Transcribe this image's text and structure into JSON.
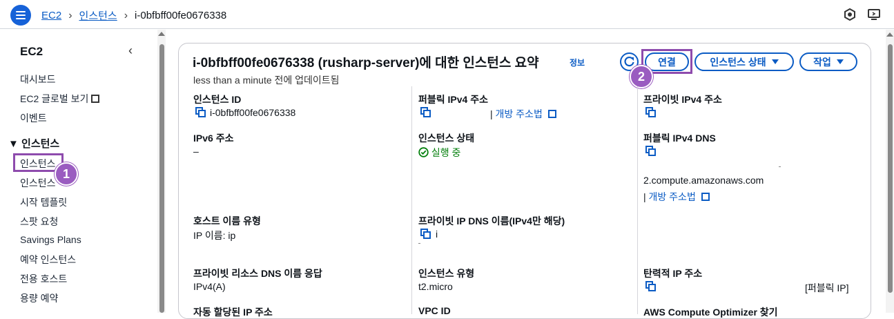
{
  "topbar": {
    "breadcrumbs": [
      "EC2",
      "인스턴스"
    ],
    "current": "i-0bfbff00fe0676338"
  },
  "sidebar": {
    "title": "EC2",
    "items_top": [
      "대시보드",
      "EC2 글로벌 보기",
      "이벤트"
    ],
    "section": "▼ 인스턴스",
    "items": [
      "인스턴스",
      "인스턴스 유형",
      "시작 템플릿",
      "스팟 요청",
      "Savings Plans",
      "예약 인스턴스",
      "전용 호스트",
      "용량 예약"
    ],
    "items_visible": [
      "인스턴스",
      "인스턴스",
      "시작 템플릿",
      "스팟 요청",
      "Savings Plans",
      "예약 인스턴스",
      "전용 호스트",
      "용량 예약"
    ]
  },
  "annotations": {
    "badge1": "1",
    "badge2": "2"
  },
  "summary": {
    "title": "i-0bfbff00fe0676338 (rusharp-server)에 대한 인스턴스 요약",
    "info": "정보",
    "updated": "less than a minute 전에 업데이트됨",
    "connect_label": "연결",
    "state_label": "인스턴스 상태",
    "actions_label": "작업",
    "fields": {
      "instance_id_label": "인스턴스 ID",
      "instance_id_value": "i-0bfbff00fe0676338",
      "public_ipv4_label": "퍼블릭 IPv4 주소",
      "open_address_link": "개방 주소법",
      "private_ipv4_label": "프라이빗 IPv4 주소",
      "ipv6_label": "IPv6 주소",
      "ipv6_value": "–",
      "instance_state_label": "인스턴스 상태",
      "instance_state_value": "실행 중",
      "public_dns_label": "퍼블릭 IPv4 DNS",
      "public_dns_value": "2.compute.amazonaws.com",
      "public_dns_link": "개방 주소법",
      "hostname_type_label": "호스트 이름 유형",
      "hostname_type_value": "IP 이름: ip",
      "private_dns_label": "프라이빗 IP DNS 이름(IPv4만 해당)",
      "private_dns_value": "i",
      "private_resource_dns_label": "프라이빗 리소스 DNS 이름 응답",
      "private_resource_dns_value": "IPv4(A)",
      "instance_type_label": "인스턴스 유형",
      "instance_type_value": "t2.micro",
      "elastic_ip_label": "탄력적 IP 주소",
      "elastic_ip_value": "[퍼블릭 IP]",
      "auto_ip_label": "자동 할당된 IP 주소",
      "vpc_label": "VPC ID",
      "optimizer_label": "AWS Compute Optimizer 찾기"
    }
  },
  "colors": {
    "accent": "#0a5bc4",
    "brand": "#1662d8",
    "annotation": "#8e4bad",
    "running": "#037f0c"
  }
}
